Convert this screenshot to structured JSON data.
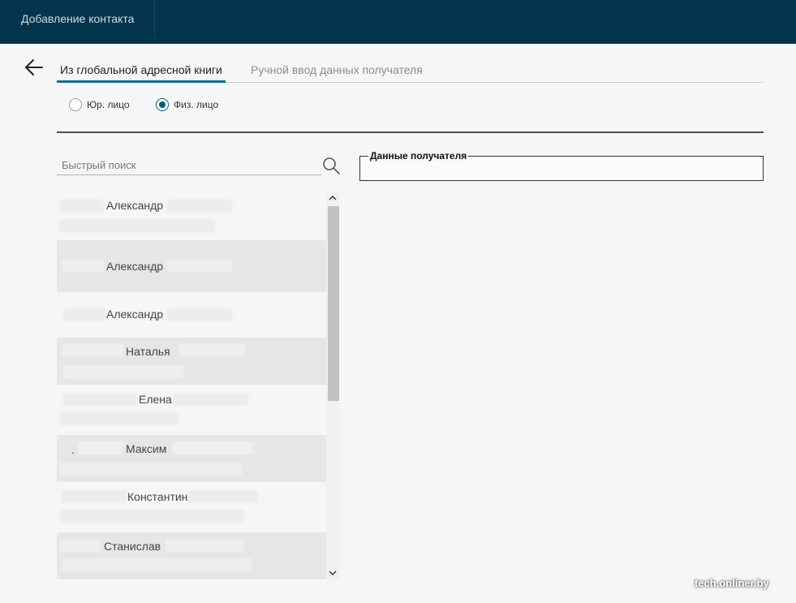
{
  "header": {
    "title": "Добавление контакта"
  },
  "tabs": [
    {
      "label": "Из глобальной адресной книги",
      "active": true
    },
    {
      "label": "Ручной ввод данных получателя",
      "active": false
    }
  ],
  "entity_type": {
    "options": [
      {
        "label": "Юр. лицо",
        "selected": false
      },
      {
        "label": "Физ. лицо",
        "selected": true
      }
    ]
  },
  "search": {
    "placeholder": "Быстрый поиск"
  },
  "contacts": [
    {
      "name": "Александр"
    },
    {
      "name": "Александр"
    },
    {
      "name": "Александр"
    },
    {
      "name": "Наталья"
    },
    {
      "name": "Елена"
    },
    {
      "name": "Максим",
      "prefix": "."
    },
    {
      "name": "Константин"
    },
    {
      "name": "Станислав"
    }
  ],
  "recipient_panel": {
    "legend": "Данные получателя"
  },
  "watermark": "tech.onliner.by",
  "colors": {
    "header_bg": "#04344d",
    "accent": "#0b6d94",
    "row_shade": "#e6e6e6"
  }
}
